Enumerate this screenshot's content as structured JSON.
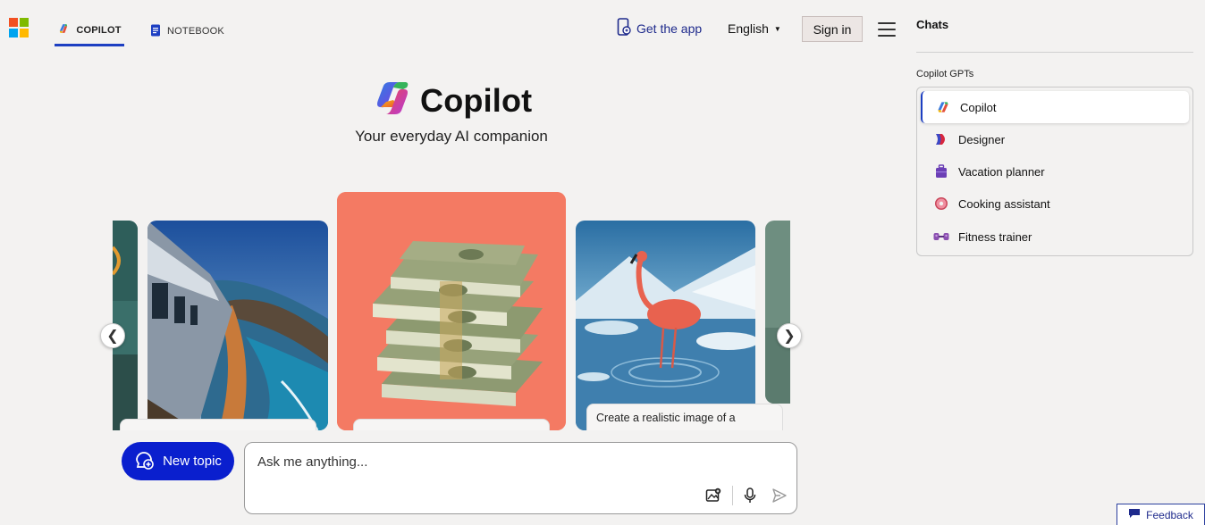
{
  "header": {
    "tabs": [
      {
        "label": "COPILOT",
        "icon": "copilot-icon",
        "active": true
      },
      {
        "label": "NOTEBOOK",
        "icon": "notebook-icon",
        "active": false
      }
    ],
    "get_app_label": "Get the app",
    "language": "English",
    "sign_in_label": "Sign in"
  },
  "hero": {
    "title": "Copilot",
    "tagline": "Your everyday AI companion"
  },
  "carousel": {
    "visible_captions": [
      "Create a realistic image of a"
    ],
    "cards": [
      {
        "subject": "train along coastal cliffs"
      },
      {
        "subject": "stack of money"
      },
      {
        "subject": "flamingo in icy water"
      }
    ]
  },
  "composer": {
    "new_topic_label": "New topic",
    "placeholder": "Ask me anything...",
    "icons": [
      "image-upload-icon",
      "microphone-icon",
      "send-icon"
    ]
  },
  "sidebar": {
    "chats_title": "Chats",
    "gpts_title": "Copilot GPTs",
    "gpts": [
      {
        "label": "Copilot",
        "icon": "copilot-icon",
        "active": true
      },
      {
        "label": "Designer",
        "icon": "designer-icon",
        "active": false
      },
      {
        "label": "Vacation planner",
        "icon": "suitcase-icon",
        "active": false
      },
      {
        "label": "Cooking assistant",
        "icon": "donut-icon",
        "active": false
      },
      {
        "label": "Fitness trainer",
        "icon": "dumbbell-icon",
        "active": false
      }
    ]
  },
  "feedback_label": "Feedback",
  "colors": {
    "accent": "#0a1fce",
    "tab_underline": "#1d3fc2",
    "background": "#f3f2f1",
    "money_card_bg": "#f47a63"
  }
}
